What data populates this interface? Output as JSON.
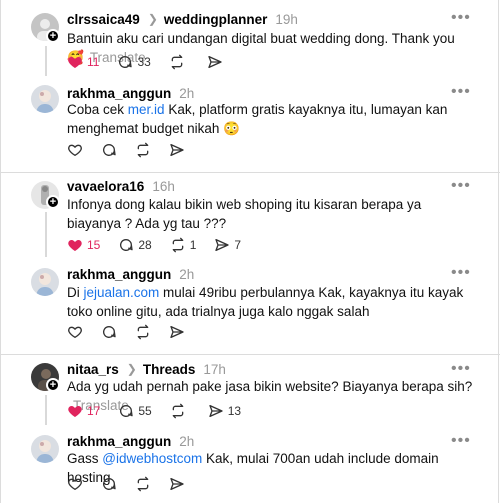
{
  "threads": [
    {
      "post": {
        "username": "clrssaica49",
        "context_label": "weddingplanner",
        "time": "19h",
        "text": "Bantuin aku cari undangan digital buat wedding dong. Thank you🥰",
        "translate": "Translate",
        "likes": "11",
        "replies": "33",
        "reposts": "",
        "shares": "",
        "liked": true
      },
      "reply": {
        "username": "rakhma_anggun",
        "time": "2h",
        "text_before": "Coba cek ",
        "link": "mer.id",
        "text_after": " Kak, platform gratis kayaknya itu, lumayan kan menghemat budget nikah 😳"
      }
    },
    {
      "post": {
        "username": "vavaelora16",
        "time": "16h",
        "text": "Infonya dong kalau bikin web shoping itu kisaran berapa ya biayanya ? Ada yg tau ???",
        "likes": "15",
        "replies": "28",
        "reposts": "1",
        "shares": "7",
        "liked": true
      },
      "reply": {
        "username": "rakhma_anggun",
        "time": "2h",
        "text_before": "Di ",
        "link": "jejualan.com",
        "text_after": " mulai 49ribu perbulannya Kak, kayaknya itu kayak toko online gitu, ada trialnya juga kalo nggak salah"
      }
    },
    {
      "post": {
        "username": "nitaa_rs",
        "context_label": "Threads",
        "time": "17h",
        "text": "Ada yg udah pernah pake jasa bikin website? Biayanya berapa sih?",
        "translate": "Translate",
        "likes": "17",
        "replies": "55",
        "reposts": "",
        "shares": "13",
        "liked": true
      },
      "reply": {
        "username": "rakhma_anggun",
        "time": "2h",
        "text_before": "Gass ",
        "link": "@idwebhostcom",
        "text_after": " Kak, mulai 700an udah include domain hosting"
      }
    }
  ],
  "colors": {
    "link": "#1a73e8",
    "like": "#e0245e",
    "muted": "#999999",
    "divider": "#dcdcdc"
  },
  "icons": [
    "heart-icon",
    "comment-icon",
    "repost-icon",
    "share-icon",
    "more-icon",
    "follow-plus-icon"
  ]
}
